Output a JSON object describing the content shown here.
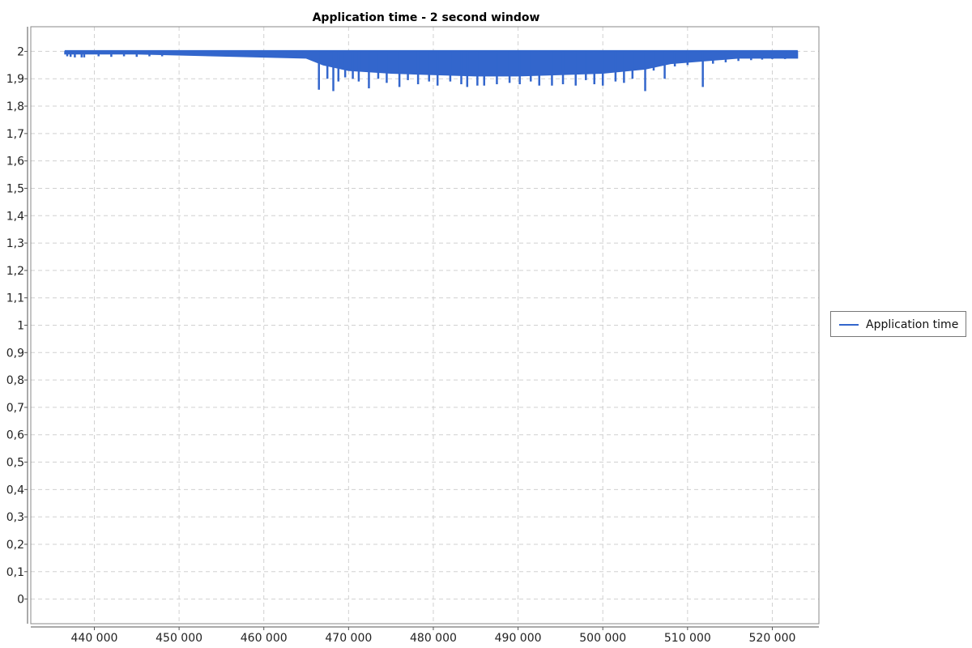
{
  "chart_data": {
    "type": "line",
    "title": "Application time - 2 second window",
    "xlabel": "",
    "ylabel": "",
    "xlim": [
      432500,
      525500
    ],
    "ylim": [
      -0.09,
      2.09
    ],
    "x_ticks": [
      440000,
      450000,
      460000,
      470000,
      480000,
      490000,
      500000,
      510000,
      520000
    ],
    "x_tick_labels": [
      "440 000",
      "450 000",
      "460 000",
      "470 000",
      "480 000",
      "490 000",
      "500 000",
      "510 000",
      "520 000"
    ],
    "y_ticks": [
      0,
      0.1,
      0.2,
      0.3,
      0.4,
      0.5,
      0.6,
      0.7,
      0.8,
      0.9,
      1,
      1.1,
      1.2,
      1.3,
      1.4,
      1.5,
      1.6,
      1.7,
      1.8,
      1.9,
      2
    ],
    "y_tick_labels": [
      "0",
      "0,1",
      "0,2",
      "0,3",
      "0,4",
      "0,5",
      "0,6",
      "0,7",
      "0,8",
      "0,9",
      "1",
      "1,1",
      "1,2",
      "1,3",
      "1,4",
      "1,5",
      "1,6",
      "1,7",
      "1,8",
      "1,9",
      "2"
    ],
    "grid": true,
    "legend_position": "right",
    "series": [
      {
        "name": "Application time",
        "color": "#3366cc",
        "band": {
          "x": [
            436500,
            445000,
            465000,
            467000,
            470000,
            475000,
            480000,
            485000,
            490000,
            495000,
            500000,
            505000,
            508000,
            512000,
            516000,
            520000,
            523000
          ],
          "min": [
            1.99,
            1.99,
            1.975,
            1.95,
            1.93,
            1.92,
            1.915,
            1.91,
            1.91,
            1.915,
            1.92,
            1.935,
            1.955,
            1.965,
            1.975,
            1.975,
            1.975
          ],
          "max": [
            2,
            2,
            2,
            2,
            2,
            2,
            2,
            2,
            2,
            2,
            2,
            2,
            2,
            2,
            2,
            2,
            2
          ]
        },
        "dips": [
          {
            "x": 436800,
            "y": 1.982
          },
          {
            "x": 437200,
            "y": 1.98
          },
          {
            "x": 437700,
            "y": 1.978
          },
          {
            "x": 438500,
            "y": 1.978
          },
          {
            "x": 438800,
            "y": 1.978
          },
          {
            "x": 440500,
            "y": 1.982
          },
          {
            "x": 442000,
            "y": 1.98
          },
          {
            "x": 443500,
            "y": 1.982
          },
          {
            "x": 445000,
            "y": 1.98
          },
          {
            "x": 446500,
            "y": 1.982
          },
          {
            "x": 448000,
            "y": 1.982
          },
          {
            "x": 450000,
            "y": 1.985
          },
          {
            "x": 452000,
            "y": 1.984
          },
          {
            "x": 454000,
            "y": 1.983
          },
          {
            "x": 456000,
            "y": 1.984
          },
          {
            "x": 458000,
            "y": 1.985
          },
          {
            "x": 460000,
            "y": 1.984
          },
          {
            "x": 461500,
            "y": 1.982
          },
          {
            "x": 462500,
            "y": 1.98
          },
          {
            "x": 463300,
            "y": 1.98
          },
          {
            "x": 464000,
            "y": 1.978
          },
          {
            "x": 464700,
            "y": 1.975
          },
          {
            "x": 465500,
            "y": 1.97
          },
          {
            "x": 466500,
            "y": 1.86
          },
          {
            "x": 467500,
            "y": 1.9
          },
          {
            "x": 468200,
            "y": 1.855
          },
          {
            "x": 468800,
            "y": 1.89
          },
          {
            "x": 469600,
            "y": 1.905
          },
          {
            "x": 470500,
            "y": 1.9
          },
          {
            "x": 471200,
            "y": 1.89
          },
          {
            "x": 472400,
            "y": 1.865
          },
          {
            "x": 473500,
            "y": 1.9
          },
          {
            "x": 474500,
            "y": 1.885
          },
          {
            "x": 476000,
            "y": 1.87
          },
          {
            "x": 477000,
            "y": 1.895
          },
          {
            "x": 478200,
            "y": 1.88
          },
          {
            "x": 479500,
            "y": 1.89
          },
          {
            "x": 480500,
            "y": 1.875
          },
          {
            "x": 482000,
            "y": 1.89
          },
          {
            "x": 483300,
            "y": 1.88
          },
          {
            "x": 484000,
            "y": 1.87
          },
          {
            "x": 485200,
            "y": 1.875
          },
          {
            "x": 486000,
            "y": 1.875
          },
          {
            "x": 487500,
            "y": 1.88
          },
          {
            "x": 489000,
            "y": 1.885
          },
          {
            "x": 490200,
            "y": 1.88
          },
          {
            "x": 491500,
            "y": 1.89
          },
          {
            "x": 492500,
            "y": 1.875
          },
          {
            "x": 494000,
            "y": 1.875
          },
          {
            "x": 495300,
            "y": 1.88
          },
          {
            "x": 496800,
            "y": 1.875
          },
          {
            "x": 498000,
            "y": 1.895
          },
          {
            "x": 499000,
            "y": 1.88
          },
          {
            "x": 500000,
            "y": 1.875
          },
          {
            "x": 501500,
            "y": 1.89
          },
          {
            "x": 502500,
            "y": 1.885
          },
          {
            "x": 503500,
            "y": 1.9
          },
          {
            "x": 505000,
            "y": 1.855
          },
          {
            "x": 506000,
            "y": 1.93
          },
          {
            "x": 507300,
            "y": 1.9
          },
          {
            "x": 508500,
            "y": 1.945
          },
          {
            "x": 510000,
            "y": 1.95
          },
          {
            "x": 511800,
            "y": 1.87
          },
          {
            "x": 513000,
            "y": 1.955
          },
          {
            "x": 514500,
            "y": 1.96
          },
          {
            "x": 516000,
            "y": 1.965
          },
          {
            "x": 517500,
            "y": 1.968
          },
          {
            "x": 518800,
            "y": 1.97
          },
          {
            "x": 520000,
            "y": 1.972
          },
          {
            "x": 521500,
            "y": 1.972
          },
          {
            "x": 522600,
            "y": 1.975
          }
        ]
      }
    ]
  }
}
